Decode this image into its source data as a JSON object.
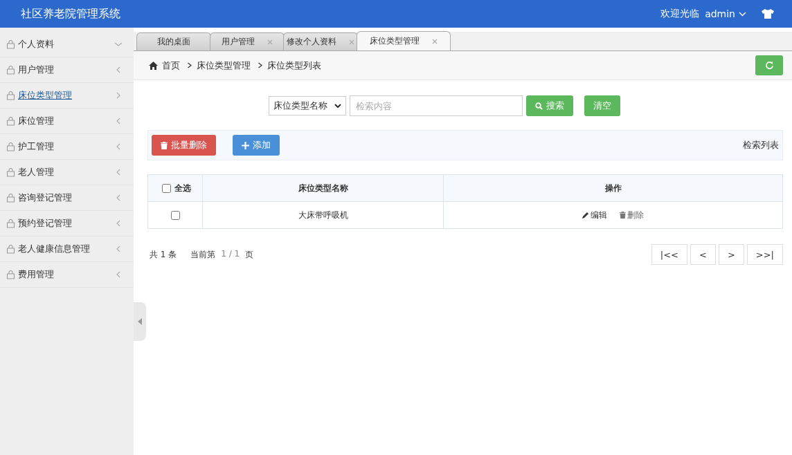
{
  "header": {
    "title": "社区养老院管理系统",
    "welcome": "欢迎光临",
    "user": "admin"
  },
  "sidebar": {
    "items": [
      {
        "label": "个人资料",
        "selected": false,
        "expanded": true
      },
      {
        "label": "用户管理",
        "selected": false,
        "expanded": false
      },
      {
        "label": "床位类型管理",
        "selected": true,
        "expanded": false
      },
      {
        "label": "床位管理",
        "selected": false,
        "expanded": false
      },
      {
        "label": "护工管理",
        "selected": false,
        "expanded": false
      },
      {
        "label": "老人管理",
        "selected": false,
        "expanded": false
      },
      {
        "label": "咨询登记管理",
        "selected": false,
        "expanded": false
      },
      {
        "label": "预约登记管理",
        "selected": false,
        "expanded": false
      },
      {
        "label": "老人健康信息管理",
        "selected": false,
        "expanded": false
      },
      {
        "label": "费用管理",
        "selected": false,
        "expanded": false
      }
    ]
  },
  "tabs": [
    {
      "label": "我的桌面",
      "selected": false,
      "closable": false
    },
    {
      "label": "用户管理",
      "selected": false,
      "closable": true
    },
    {
      "label": "修改个人资料",
      "selected": false,
      "closable": true
    },
    {
      "label": "床位类型管理",
      "selected": true,
      "closable": true
    }
  ],
  "breadcrumb": [
    "首页",
    "床位类型管理",
    "床位类型列表"
  ],
  "search": {
    "field": "床位类型名称",
    "placeholder": "检索内容",
    "search_button": "搜索",
    "clear_button": "清空"
  },
  "toolbar": {
    "batch_delete": "批量删除",
    "add": "添加",
    "caption": "检索列表"
  },
  "table": {
    "select_all": "全选",
    "select_all_checked": false,
    "columns": [
      "床位类型名称",
      "操作"
    ],
    "rows": [
      {
        "checked": false,
        "name": "大床带呼吸机",
        "edit": "编辑",
        "delete": "删除"
      }
    ]
  },
  "pagination": {
    "total": "共 1 条",
    "current_label": "当前第",
    "current": "1 / 1",
    "unit": "页",
    "buttons": [
      "|<<",
      "<",
      ">",
      ">>|"
    ]
  }
}
